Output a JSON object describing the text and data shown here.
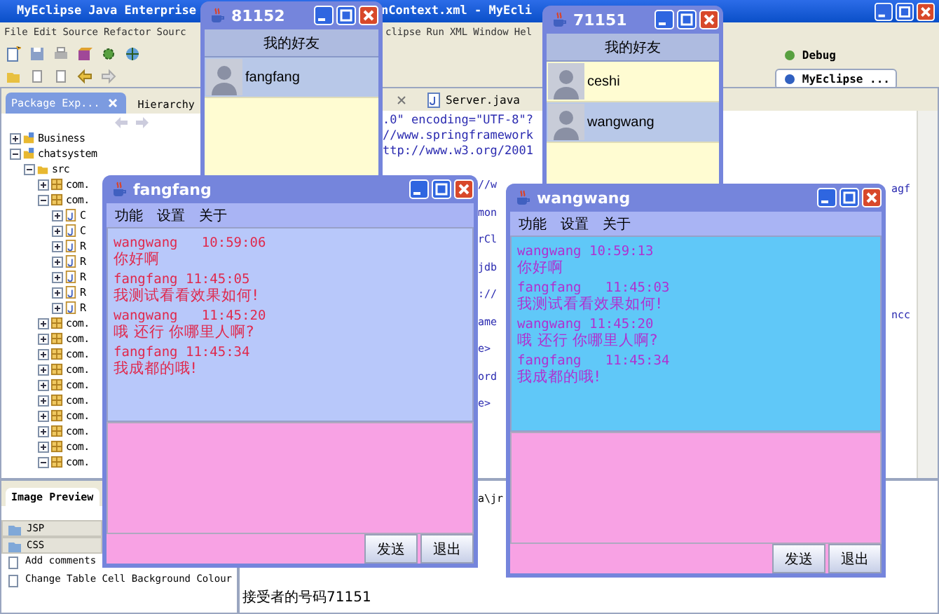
{
  "ide": {
    "title": [
      "MyEclipse Java Enterprise",
      "nContext.xml - MyEcli"
    ],
    "menu_left": [
      "File",
      "Edit",
      "Source",
      "Refactor",
      "Sourc"
    ],
    "menu_right": [
      "clipse",
      "Run",
      "XML",
      "Window",
      "Hel"
    ],
    "perspectives": [
      {
        "label": "Debug",
        "selected": false
      },
      {
        "label": "MyEclipse ...",
        "selected": true
      }
    ],
    "explorer_tabs": [
      {
        "label": "Package Exp...",
        "selected": true
      },
      {
        "label": "Hierarchy",
        "selected": false
      }
    ],
    "tree": [
      {
        "label": "Business",
        "kind": "project",
        "expanded": false
      },
      {
        "label": "chatsystem",
        "kind": "project",
        "expanded": true,
        "children": [
          {
            "label": "src",
            "kind": "folder",
            "expanded": true,
            "children": [
              {
                "label": "com.",
                "kind": "package",
                "expanded": false
              },
              {
                "label": "com.",
                "kind": "package",
                "expanded": true,
                "children": [
                  {
                    "label": "C",
                    "kind": "file",
                    "expanded": false
                  },
                  {
                    "label": "C",
                    "kind": "file",
                    "expanded": false
                  },
                  {
                    "label": "R",
                    "kind": "file",
                    "expanded": false
                  },
                  {
                    "label": "R",
                    "kind": "file",
                    "expanded": false
                  },
                  {
                    "label": "R",
                    "kind": "file",
                    "expanded": false
                  },
                  {
                    "label": "R",
                    "kind": "file",
                    "expanded": false
                  },
                  {
                    "label": "R",
                    "kind": "file",
                    "expanded": false
                  }
                ]
              },
              {
                "label": "com.",
                "kind": "package",
                "expanded": false
              },
              {
                "label": "com.",
                "kind": "package",
                "expanded": false
              },
              {
                "label": "com.",
                "kind": "package",
                "expanded": false
              },
              {
                "label": "com.",
                "kind": "package",
                "expanded": false
              },
              {
                "label": "com.",
                "kind": "package",
                "expanded": false
              },
              {
                "label": "com.",
                "kind": "package",
                "expanded": false
              },
              {
                "label": "com.",
                "kind": "package",
                "expanded": false
              },
              {
                "label": "com.",
                "kind": "package",
                "expanded": false
              },
              {
                "label": "com.",
                "kind": "package",
                "expanded": false
              },
              {
                "label": "com.",
                "kind": "package",
                "expanded": true
              }
            ]
          }
        ]
      }
    ],
    "editor_tabs": [
      {
        "label": "Server.java",
        "selected": false
      }
    ],
    "code_lines": [
      ".0\" encoding=\"UTF-8\"?",
      "//www.springframework",
      "ttp://www.w3.org/2001"
    ],
    "code_fragments_mid": [
      "//w",
      "mon",
      "rCl",
      "jdb",
      "://",
      "ame",
      "e>",
      "ord",
      "e>"
    ],
    "code_fragments_right": [
      "agf",
      "ncc"
    ],
    "bottom_tabs": [
      {
        "label": "Image Preview",
        "selected": true
      }
    ],
    "palette": [
      {
        "label": "JSP",
        "kind": "drawer"
      },
      {
        "label": "CSS",
        "kind": "drawer"
      },
      {
        "label": "Add comments",
        "kind": "item"
      },
      {
        "label": "Change Table Cell Background Colour",
        "kind": "item"
      }
    ],
    "console": [
      {
        "kind": "fragment",
        "text": "a\\jr"
      },
      {
        "kind": "line",
        "text": "接受者的号码71151"
      }
    ]
  },
  "friend_windows": [
    {
      "title": "81152",
      "header": "我的好友",
      "friends": [
        {
          "name": "fangfang",
          "selected": true
        }
      ]
    },
    {
      "title": "71151",
      "header": "我的好友",
      "friends": [
        {
          "name": "ceshi",
          "selected": false
        },
        {
          "name": "wangwang",
          "selected": true
        }
      ]
    }
  ],
  "chat_windows": [
    {
      "title": "fangfang",
      "menu": [
        "功能",
        "设置",
        "关于"
      ],
      "messages": [
        {
          "from": "wangwang   10:59:06",
          "text": "你好啊"
        },
        {
          "from": "fangfang 11:45:05",
          "text": "我测试看看效果如何!"
        },
        {
          "from": "wangwang   11:45:20",
          "text": "哦 还行 你哪里人啊?"
        },
        {
          "from": "fangfang 11:45:34",
          "text": "我成都的哦!"
        }
      ],
      "buttons": [
        "发送",
        "退出"
      ]
    },
    {
      "title": "wangwang",
      "menu": [
        "功能",
        "设置",
        "关于"
      ],
      "messages": [
        {
          "from": "wangwang 10:59:13",
          "text": "你好啊"
        },
        {
          "from": "fangfang   11:45:03",
          "text": "我测试看看效果如何!"
        },
        {
          "from": "wangwang 11:45:20",
          "text": "哦 还行 你哪里人啊?"
        },
        {
          "from": "fangfang   11:45:34",
          "text": "我成都的哦!"
        }
      ],
      "buttons": [
        "发送",
        "退出"
      ]
    }
  ]
}
